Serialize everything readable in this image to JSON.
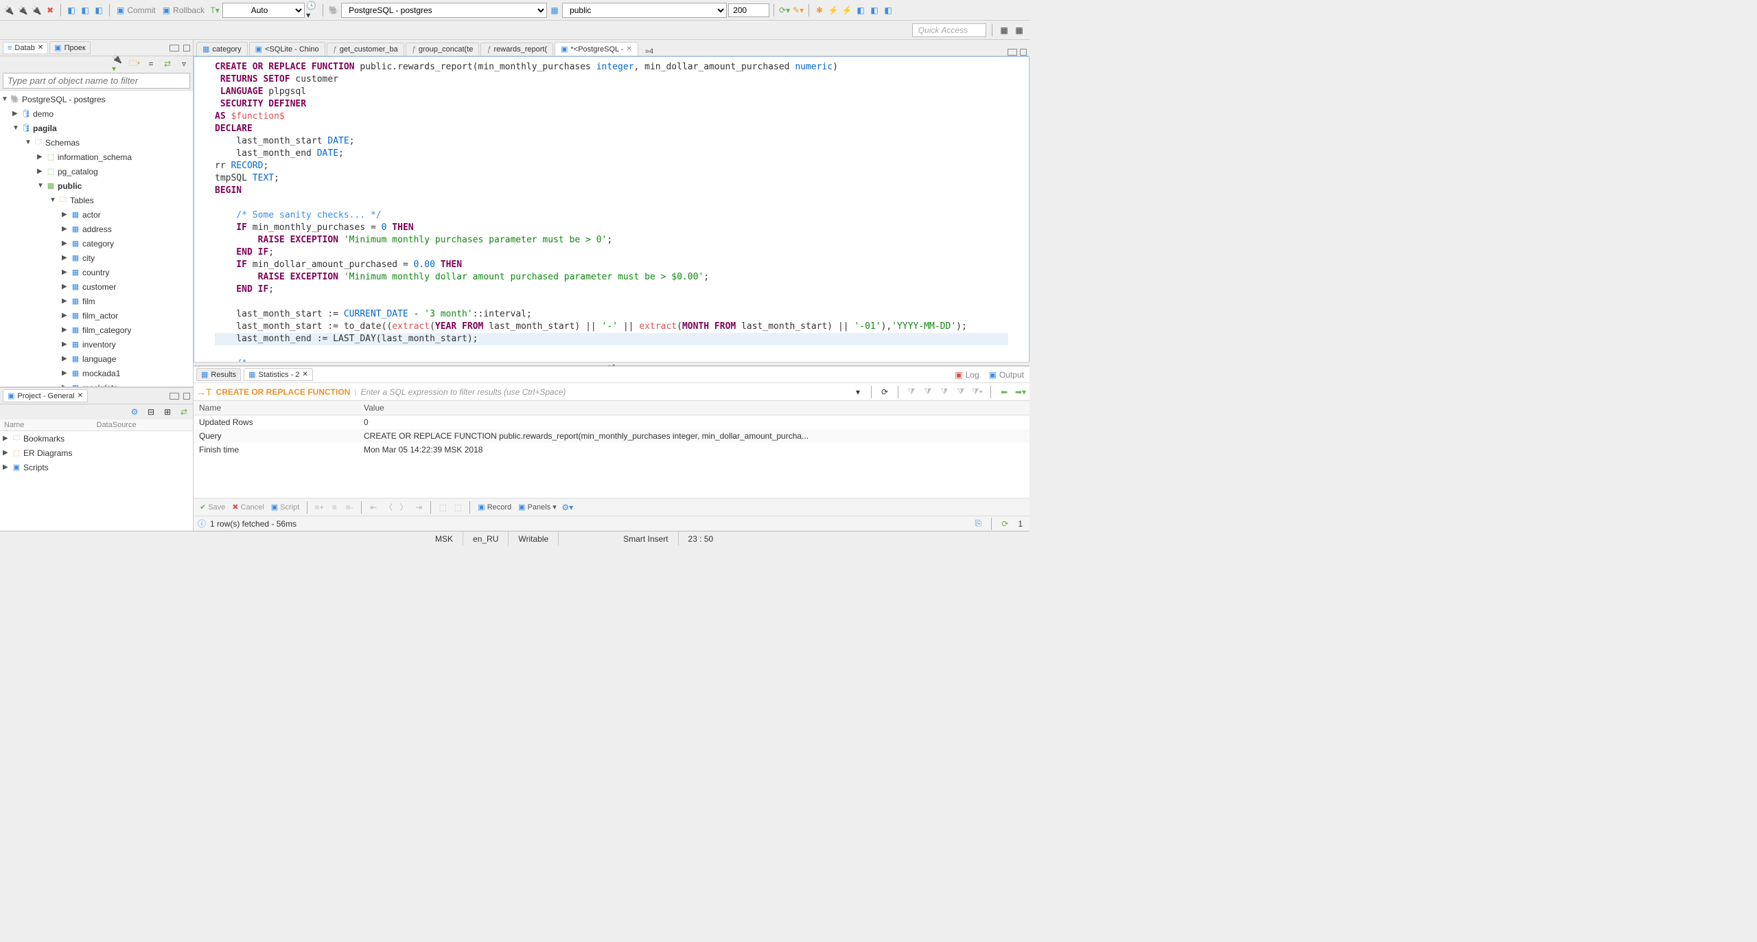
{
  "toolbar": {
    "commit_label": "Commit",
    "rollback_label": "Rollback",
    "auto_label": "Auto",
    "conn_label": "PostgreSQL - postgres",
    "schema_label": "public",
    "limit_value": "200"
  },
  "quick_access": "Quick Access",
  "left_panel": {
    "tab1": "Datab",
    "tab2": "Проек",
    "filter_placeholder": "Type part of object name to filter",
    "tree": {
      "root": "PostgreSQL - postgres",
      "db1": "demo",
      "db2": "pagila",
      "schemas_label": "Schemas",
      "schema1": "information_schema",
      "schema2": "pg_catalog",
      "schema3": "public",
      "tables_label": "Tables",
      "tables": [
        "actor",
        "address",
        "category",
        "city",
        "country",
        "customer",
        "film",
        "film_actor",
        "film_category",
        "inventory",
        "language",
        "mockada1",
        "mockdata"
      ]
    }
  },
  "project_panel": {
    "title": "Project - General",
    "col1": "Name",
    "col2": "DataSource",
    "items": [
      "Bookmarks",
      "ER Diagrams",
      "Scripts"
    ]
  },
  "editor_tabs": [
    {
      "label": "category",
      "icon": "table"
    },
    {
      "label": "<SQLite - Chino",
      "icon": "sql"
    },
    {
      "label": "get_customer_ba",
      "icon": "fn"
    },
    {
      "label": "group_concat(te",
      "icon": "fn"
    },
    {
      "label": "rewards_report(",
      "icon": "fn"
    },
    {
      "label": "*<PostgreSQL -",
      "icon": "sql",
      "active": true
    }
  ],
  "overflow_count": "»4",
  "code": {
    "l1a": "CREATE OR REPLACE FUNCTION",
    "l1b": " public.rewards_report(min_monthly_purchases ",
    "l1c": "integer",
    "l1d": ", min_dollar_amount_purchased ",
    "l1e": "numeric",
    "l1f": ")",
    "l2a": " RETURNS SETOF",
    "l2b": " customer",
    "l3a": " LANGUAGE",
    "l3b": " plpgsql",
    "l4": " SECURITY DEFINER",
    "l5a": "AS ",
    "l5b": "$function$",
    "l6": "DECLARE",
    "l7a": "    last_month_start ",
    "l7b": "DATE",
    "l7c": ";",
    "l8a": "    last_month_end ",
    "l8b": "DATE",
    "l8c": ";",
    "l9a": "rr ",
    "l9b": "RECORD",
    "l9c": ";",
    "l10a": "tmpSQL ",
    "l10b": "TEXT",
    "l10c": ";",
    "l11": "BEGIN",
    "l13": "    /* Some sanity checks... */",
    "l14a": "    IF",
    "l14b": " min_monthly_purchases = ",
    "l14c": "0 ",
    "l14d": "THEN",
    "l15a": "        RAISE EXCEPTION ",
    "l15b": "'Minimum monthly purchases parameter must be > 0'",
    "l15c": ";",
    "l16a": "    END ",
    "l16b": "IF",
    "l16c": ";",
    "l17a": "    IF",
    "l17b": " min_dollar_amount_purchased = ",
    "l17c": "0.00 ",
    "l17d": "THEN",
    "l18a": "        RAISE EXCEPTION ",
    "l18b": "'Minimum monthly dollar amount purchased parameter must be > $0.00'",
    "l18c": ";",
    "l19a": "    END ",
    "l19b": "IF",
    "l19c": ";",
    "l21a": "    last_month_start := ",
    "l21b": "CURRENT_DATE",
    "l21c": " - ",
    "l21d": "'3 month'",
    "l21e": "::interval;",
    "l22a": "    last_month_start := to_date((",
    "l22b": "extract",
    "l22c": "(",
    "l22d": "YEAR FROM",
    "l22e": " last_month_start) || ",
    "l22f": "'-'",
    "l22g": " || ",
    "l22h": "extract",
    "l22i": "(",
    "l22j": "MONTH FROM",
    "l22k": " last_month_start) || ",
    "l22l": "'-01'",
    "l22m": "),",
    "l22n": "'YYYY-MM-DD'",
    "l22o": ");",
    "l23": "    last_month_end := LAST_DAY(last_month_start);",
    "l25": "    /*"
  },
  "results": {
    "tab1": "Results",
    "tab2": "Statistics - 2",
    "log_btn": "Log",
    "output_btn": "Output",
    "filter_sql": "CREATE OR REPLACE FUNCTION",
    "filter_hint": "Enter a SQL expression to filter results (use Ctrl+Space)",
    "col_name": "Name",
    "col_value": "Value",
    "rows": [
      {
        "name": "Updated Rows",
        "value": "0"
      },
      {
        "name": "Query",
        "value": "CREATE OR REPLACE FUNCTION public.rewards_report(min_monthly_purchases integer, min_dollar_amount_purcha..."
      },
      {
        "name": "Finish time",
        "value": "Mon Mar 05 14:22:39 MSK 2018"
      }
    ],
    "footer": {
      "save": "Save",
      "cancel": "Cancel",
      "script": "Script",
      "record": "Record",
      "panels": "Panels"
    },
    "status": "1 row(s) fetched - 56ms",
    "page_num": "1"
  },
  "bottom_status": {
    "tz": "MSK",
    "locale": "en_RU",
    "mode": "Writable",
    "insert": "Smart Insert",
    "pos": "23 : 50"
  }
}
